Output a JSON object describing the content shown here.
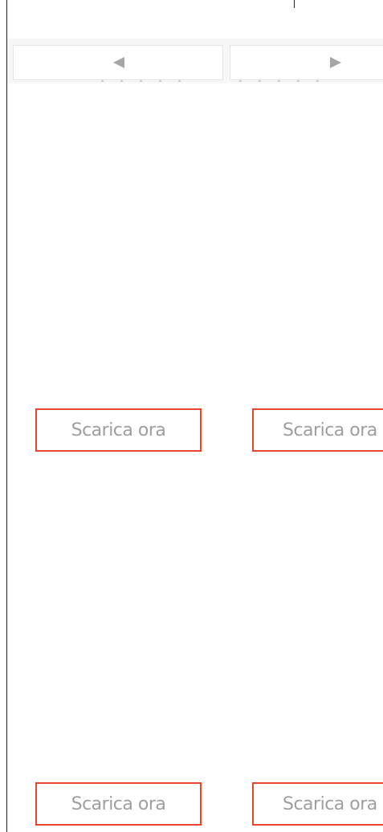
{
  "navigation": {
    "prev_icon": "triangle-left-icon",
    "next_icon": "triangle-right-icon",
    "arrow_color": "#a6a6a6"
  },
  "cards": [
    {
      "button_label": "Scarica ora"
    },
    {
      "button_label": "Scarica ora"
    },
    {
      "button_label": "Scarica ora"
    },
    {
      "button_label": "Scarica ora"
    }
  ],
  "colors": {
    "button_border": "#e8452f",
    "button_text": "#9e9e9e"
  }
}
